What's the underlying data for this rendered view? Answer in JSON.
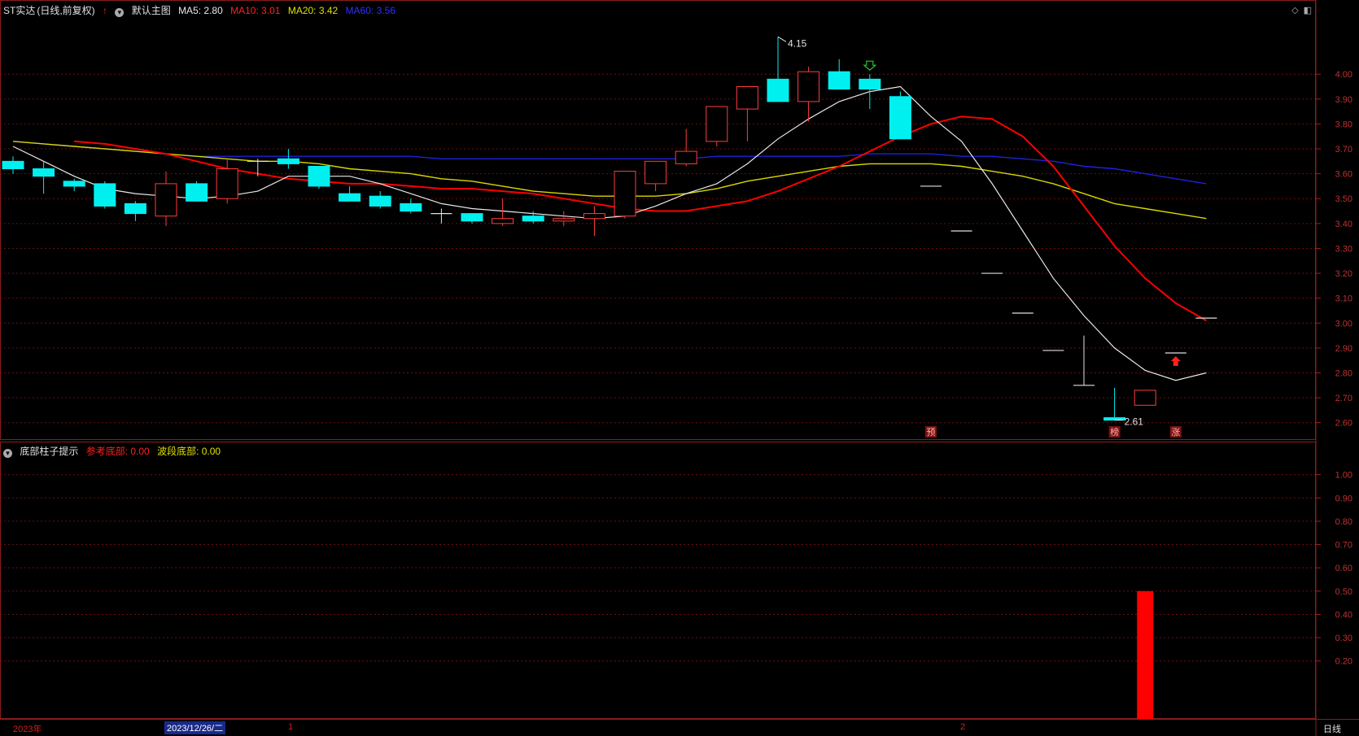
{
  "header": {
    "stock": "ST实达",
    "period": "(日线,前复权)",
    "template": "默认主图",
    "ma5": "MA5: 2.80",
    "ma10": "MA10: 3.01",
    "ma20": "MA20: 3.42",
    "ma60": "MA60: 3.56"
  },
  "subheader": {
    "title": "底部柱子提示",
    "ref_bottom": "参考底部: 0.00",
    "wave_bottom": "波段底部: 0.00"
  },
  "bottom_bar": {
    "year": "2023年",
    "date": "2023/12/26/二",
    "mark1": "1",
    "mark2": "2",
    "period_button": "日线"
  },
  "colors": {
    "up": "#ff3c3c",
    "down": "#00f0f0",
    "ma5": "#e8e8e8",
    "ma10": "#ff0000",
    "ma20": "#d8d800",
    "ma60": "#2020e0"
  },
  "chart_data": [
    {
      "type": "candlestick",
      "ylim": [
        2.55,
        4.2
      ],
      "yticks": [
        "4.00",
        "3.90",
        "3.80",
        "3.70",
        "3.60",
        "3.50",
        "3.40",
        "3.30",
        "3.20",
        "3.10",
        "3.00",
        "2.90",
        "2.80",
        "2.70",
        "2.60"
      ],
      "candles": [
        {
          "o": 3.65,
          "c": 3.62,
          "h": 3.67,
          "l": 3.6
        },
        {
          "o": 3.62,
          "c": 3.59,
          "h": 3.65,
          "l": 3.52
        },
        {
          "o": 3.57,
          "c": 3.55,
          "h": 3.58,
          "l": 3.53
        },
        {
          "o": 3.56,
          "c": 3.47,
          "h": 3.57,
          "l": 3.46
        },
        {
          "o": 3.48,
          "c": 3.44,
          "h": 3.49,
          "l": 3.41
        },
        {
          "o": 3.43,
          "c": 3.56,
          "h": 3.61,
          "l": 3.39
        },
        {
          "o": 3.56,
          "c": 3.49,
          "h": 3.57,
          "l": 3.49
        },
        {
          "o": 3.5,
          "c": 3.62,
          "h": 3.66,
          "l": 3.48
        },
        {
          "o": 3.65,
          "c": 3.65,
          "h": 3.66,
          "l": 3.59
        },
        {
          "o": 3.66,
          "c": 3.64,
          "h": 3.7,
          "l": 3.62
        },
        {
          "o": 3.63,
          "c": 3.55,
          "h": 3.63,
          "l": 3.54
        },
        {
          "o": 3.52,
          "c": 3.49,
          "h": 3.55,
          "l": 3.49
        },
        {
          "o": 3.51,
          "c": 3.47,
          "h": 3.53,
          "l": 3.46
        },
        {
          "o": 3.48,
          "c": 3.45,
          "h": 3.5,
          "l": 3.44
        },
        {
          "o": 3.44,
          "c": 3.44,
          "h": 3.46,
          "l": 3.4
        },
        {
          "o": 3.44,
          "c": 3.41,
          "h": 3.44,
          "l": 3.4
        },
        {
          "o": 3.4,
          "c": 3.42,
          "h": 3.5,
          "l": 3.39
        },
        {
          "o": 3.43,
          "c": 3.41,
          "h": 3.45,
          "l": 3.4
        },
        {
          "o": 3.41,
          "c": 3.42,
          "h": 3.45,
          "l": 3.39
        },
        {
          "o": 3.42,
          "c": 3.44,
          "h": 3.47,
          "l": 3.35
        },
        {
          "o": 3.43,
          "c": 3.61,
          "h": 3.61,
          "l": 3.42
        },
        {
          "o": 3.56,
          "c": 3.65,
          "h": 3.65,
          "l": 3.53
        },
        {
          "o": 3.64,
          "c": 3.69,
          "h": 3.78,
          "l": 3.63
        },
        {
          "o": 3.73,
          "c": 3.87,
          "h": 3.87,
          "l": 3.71
        },
        {
          "o": 3.86,
          "c": 3.95,
          "h": 3.95,
          "l": 3.73
        },
        {
          "o": 3.98,
          "c": 3.89,
          "h": 4.15,
          "l": 3.89
        },
        {
          "o": 3.89,
          "c": 4.01,
          "h": 4.03,
          "l": 3.81
        },
        {
          "o": 4.01,
          "c": 3.94,
          "h": 4.06,
          "l": 3.94
        },
        {
          "o": 3.98,
          "c": 3.94,
          "h": 4.0,
          "l": 3.86
        },
        {
          "o": 3.91,
          "c": 3.74,
          "h": 3.93,
          "l": 3.74
        },
        {
          "o": 3.55,
          "c": 3.55,
          "h": 3.55,
          "l": 3.55
        },
        {
          "o": 3.37,
          "c": 3.37,
          "h": 3.37,
          "l": 3.37
        },
        {
          "o": 3.2,
          "c": 3.2,
          "h": 3.2,
          "l": 3.2
        },
        {
          "o": 3.04,
          "c": 3.04,
          "h": 3.04,
          "l": 3.04
        },
        {
          "o": 2.89,
          "c": 2.89,
          "h": 2.89,
          "l": 2.89
        },
        {
          "o": 2.75,
          "c": 2.75,
          "h": 2.95,
          "l": 2.75
        },
        {
          "o": 2.62,
          "c": 2.61,
          "h": 2.74,
          "l": 2.61
        },
        {
          "o": 2.67,
          "c": 2.73,
          "h": 2.73,
          "l": 2.67
        },
        {
          "o": 2.88,
          "c": 2.88,
          "h": 2.88,
          "l": 2.88
        },
        {
          "o": 3.02,
          "c": 3.02,
          "h": 3.02,
          "l": 3.02
        }
      ],
      "ma5": [
        3.71,
        3.65,
        3.59,
        3.54,
        3.52,
        3.51,
        3.5,
        3.51,
        3.53,
        3.59,
        3.59,
        3.59,
        3.56,
        3.52,
        3.48,
        3.46,
        3.45,
        3.44,
        3.43,
        3.42,
        3.43,
        3.47,
        3.52,
        3.56,
        3.64,
        3.74,
        3.82,
        3.89,
        3.93,
        3.95,
        3.83,
        3.73,
        3.56,
        3.37,
        3.18,
        3.03,
        2.9,
        2.81,
        2.77,
        2.8
      ],
      "ma10": [
        3.73,
        3.72,
        3.7,
        3.68,
        3.65,
        3.62,
        3.6,
        3.58,
        3.57,
        3.56,
        3.56,
        3.55,
        3.54,
        3.54,
        3.53,
        3.52,
        3.5,
        3.48,
        3.46,
        3.45,
        3.45,
        3.47,
        3.49,
        3.53,
        3.58,
        3.63,
        3.69,
        3.75,
        3.8,
        3.83,
        3.82,
        3.75,
        3.63,
        3.47,
        3.31,
        3.18,
        3.08,
        3.01
      ],
      "ma20": [
        3.73,
        3.72,
        3.71,
        3.7,
        3.69,
        3.68,
        3.67,
        3.66,
        3.65,
        3.65,
        3.64,
        3.62,
        3.61,
        3.6,
        3.58,
        3.57,
        3.55,
        3.53,
        3.52,
        3.51,
        3.51,
        3.51,
        3.52,
        3.54,
        3.57,
        3.59,
        3.61,
        3.63,
        3.64,
        3.64,
        3.64,
        3.63,
        3.61,
        3.59,
        3.56,
        3.52,
        3.48,
        3.46,
        3.44,
        3.42
      ],
      "ma60": [
        3.73,
        3.72,
        3.71,
        3.7,
        3.69,
        3.68,
        3.67,
        3.67,
        3.67,
        3.67,
        3.67,
        3.67,
        3.67,
        3.67,
        3.66,
        3.66,
        3.66,
        3.66,
        3.66,
        3.66,
        3.66,
        3.66,
        3.66,
        3.67,
        3.67,
        3.67,
        3.67,
        3.67,
        3.68,
        3.68,
        3.68,
        3.67,
        3.67,
        3.66,
        3.65,
        3.63,
        3.62,
        3.6,
        3.58,
        3.56
      ],
      "annotations": [
        {
          "index": 25,
          "text": "4.15"
        },
        {
          "index": 36,
          "text": "2.61"
        }
      ],
      "signals": [
        {
          "index": 28,
          "type": "down-arrow-green"
        },
        {
          "index": 38,
          "type": "up-arrow-red"
        }
      ],
      "markers": [
        {
          "index": 30,
          "text": "预"
        },
        {
          "index": 36,
          "text": "榜"
        },
        {
          "index": 38,
          "text": "涨"
        }
      ]
    },
    {
      "type": "bar",
      "ylim": [
        0.0,
        1.1
      ],
      "yticks": [
        "1.00",
        "0.90",
        "0.80",
        "0.70",
        "0.60",
        "0.50",
        "0.40",
        "0.30",
        "0.20"
      ],
      "bars": [
        {
          "index": 37,
          "value": 0.5
        }
      ]
    }
  ]
}
